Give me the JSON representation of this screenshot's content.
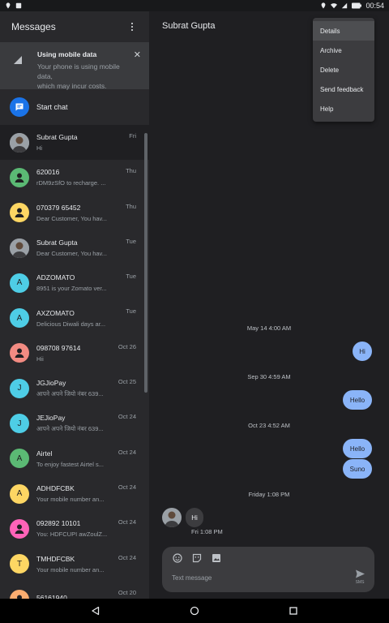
{
  "status_bar": {
    "time": "00:54"
  },
  "sidebar": {
    "title": "Messages",
    "banner": {
      "title": "Using mobile data",
      "description_line1": "Your phone is using mobile data,",
      "description_line2": "which may incur costs."
    },
    "start_chat_label": "Start chat",
    "conversations": [
      {
        "name": "Subrat Gupta",
        "snippet": "Hi",
        "date": "Fri",
        "avatar": "photo",
        "color": "#9aa0a6",
        "initial": ""
      },
      {
        "name": "620016",
        "snippet": "rDM9zSfO to recharge. ...",
        "date": "Thu",
        "avatar": "person",
        "color": "#5bb974",
        "initial": ""
      },
      {
        "name": "070379 65452",
        "snippet": "Dear Customer, You hav...",
        "date": "Thu",
        "avatar": "person",
        "color": "#fdd663",
        "initial": ""
      },
      {
        "name": "Subrat Gupta",
        "snippet": "Dear Customer, You hav...",
        "date": "Tue",
        "avatar": "photo",
        "color": "#9aa0a6",
        "initial": ""
      },
      {
        "name": "ADZOMATO",
        "snippet": "8951 is your Zomato ver...",
        "date": "Tue",
        "avatar": "letter",
        "color": "#4ecde6",
        "initial": "A"
      },
      {
        "name": "AXZOMATO",
        "snippet": "Delicious Diwali days ar...",
        "date": "Tue",
        "avatar": "letter",
        "color": "#4ecde6",
        "initial": "A"
      },
      {
        "name": "098708 97614",
        "snippet": "Hii",
        "date": "Oct 26",
        "avatar": "person",
        "color": "#f28b82",
        "initial": ""
      },
      {
        "name": "JGJioPay",
        "snippet": "आपने अपने जियो नंबर 639...",
        "date": "Oct 25",
        "avatar": "letter",
        "color": "#4ecde6",
        "initial": "J"
      },
      {
        "name": "JEJioPay",
        "snippet": "आपने अपने जियो नंबर 639...",
        "date": "Oct 24",
        "avatar": "letter",
        "color": "#4ecde6",
        "initial": "J"
      },
      {
        "name": "Airtel",
        "snippet": "To enjoy fastest Airtel s...",
        "date": "Oct 24",
        "avatar": "letter",
        "color": "#5bb974",
        "initial": "A"
      },
      {
        "name": "ADHDFCBK",
        "snippet": "Your mobile number an...",
        "date": "Oct 24",
        "avatar": "letter",
        "color": "#fdd663",
        "initial": "A"
      },
      {
        "name": "092892 10101",
        "snippet": "You: HDFCUPI awZoulZ...",
        "date": "Oct 24",
        "avatar": "person",
        "color": "#ff63b8",
        "initial": ""
      },
      {
        "name": "TMHDFCBK",
        "snippet": "Your mobile number an...",
        "date": "Oct 24",
        "avatar": "letter",
        "color": "#fdd663",
        "initial": "T"
      },
      {
        "name": "56161940",
        "snippet": "",
        "date": "Oct 20",
        "avatar": "person",
        "color": "#fcad70",
        "initial": ""
      }
    ]
  },
  "chat": {
    "contact_name": "Subrat Gupta",
    "menu": [
      "Details",
      "Archive",
      "Delete",
      "Send feedback",
      "Help"
    ],
    "timestamps": [
      "May 14 4:00 AM",
      "Sep 30 4:59 AM",
      "Oct 23 4:52 AM",
      "Friday 1:08 PM"
    ],
    "outgoing": [
      "Hi",
      "Hello",
      "Hello",
      "Suno"
    ],
    "incoming": {
      "text": "Hi",
      "time": "Fri 1:08 PM"
    },
    "composer_placeholder": "Text message",
    "send_sub_label": "SMS"
  },
  "colors": {
    "accent": "#8ab4f8",
    "start_chat": "#1a73e8"
  },
  "icons": [
    "location-icon",
    "wifi-icon",
    "battery-icon",
    "signal-icon",
    "close-icon",
    "more-vert-icon",
    "chat-icon",
    "emoji-icon",
    "sticker-icon",
    "image-icon",
    "send-icon",
    "back-icon",
    "home-icon",
    "recents-icon"
  ]
}
